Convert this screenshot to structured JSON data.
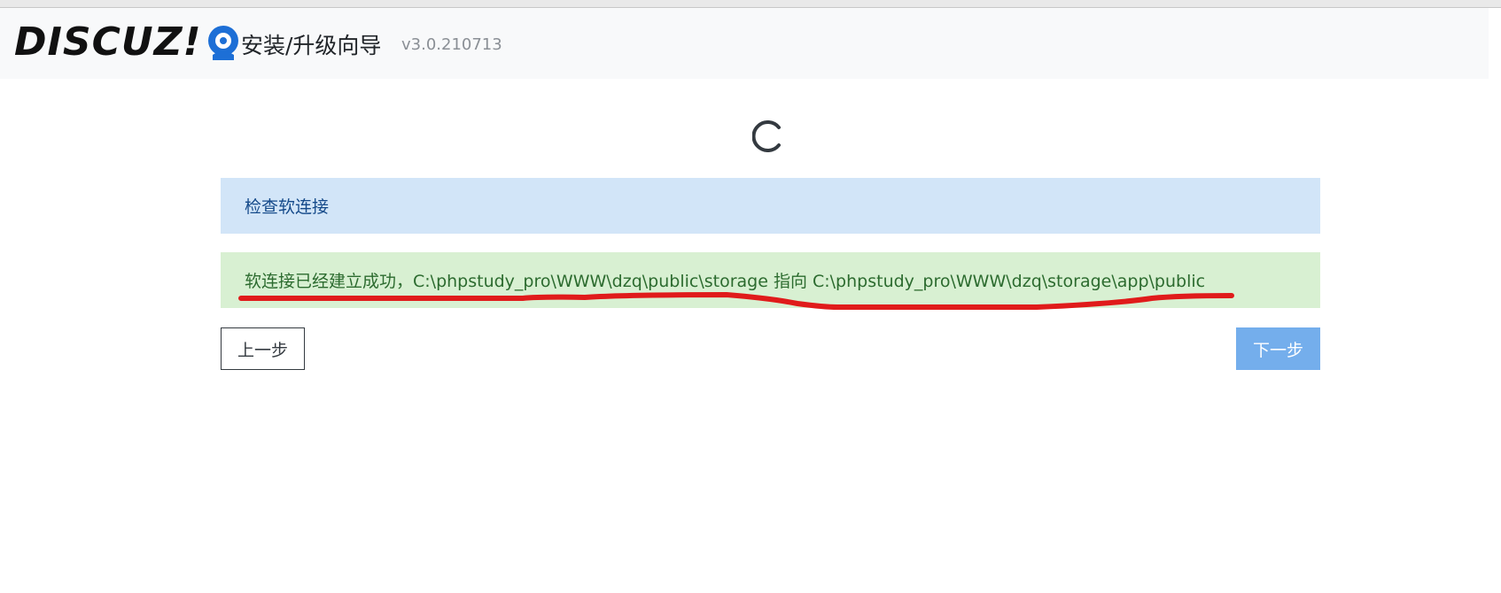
{
  "header": {
    "logo_text": "DISCUZ!",
    "title": "安装/升级向导",
    "version": "v3.0.210713"
  },
  "status": {
    "check_title": "检查软连接",
    "result_message": "软连接已经建立成功，C:\\phpstudy_pro\\WWW\\dzq\\public\\storage 指向 C:\\phpstudy_pro\\WWW\\dzq\\storage\\app\\public"
  },
  "buttons": {
    "prev_label": "上一步",
    "next_label": "下一步"
  },
  "colors": {
    "info_bg": "#d2e5f8",
    "success_bg": "#d8f0d2",
    "next_button_bg": "#74aeec",
    "annotation_stroke": "#e01b1b",
    "logo_accent": "#1d6fd6"
  },
  "icons": {
    "spinner": "loading-spinner-icon",
    "logo": "discuz-q-logo-icon"
  }
}
